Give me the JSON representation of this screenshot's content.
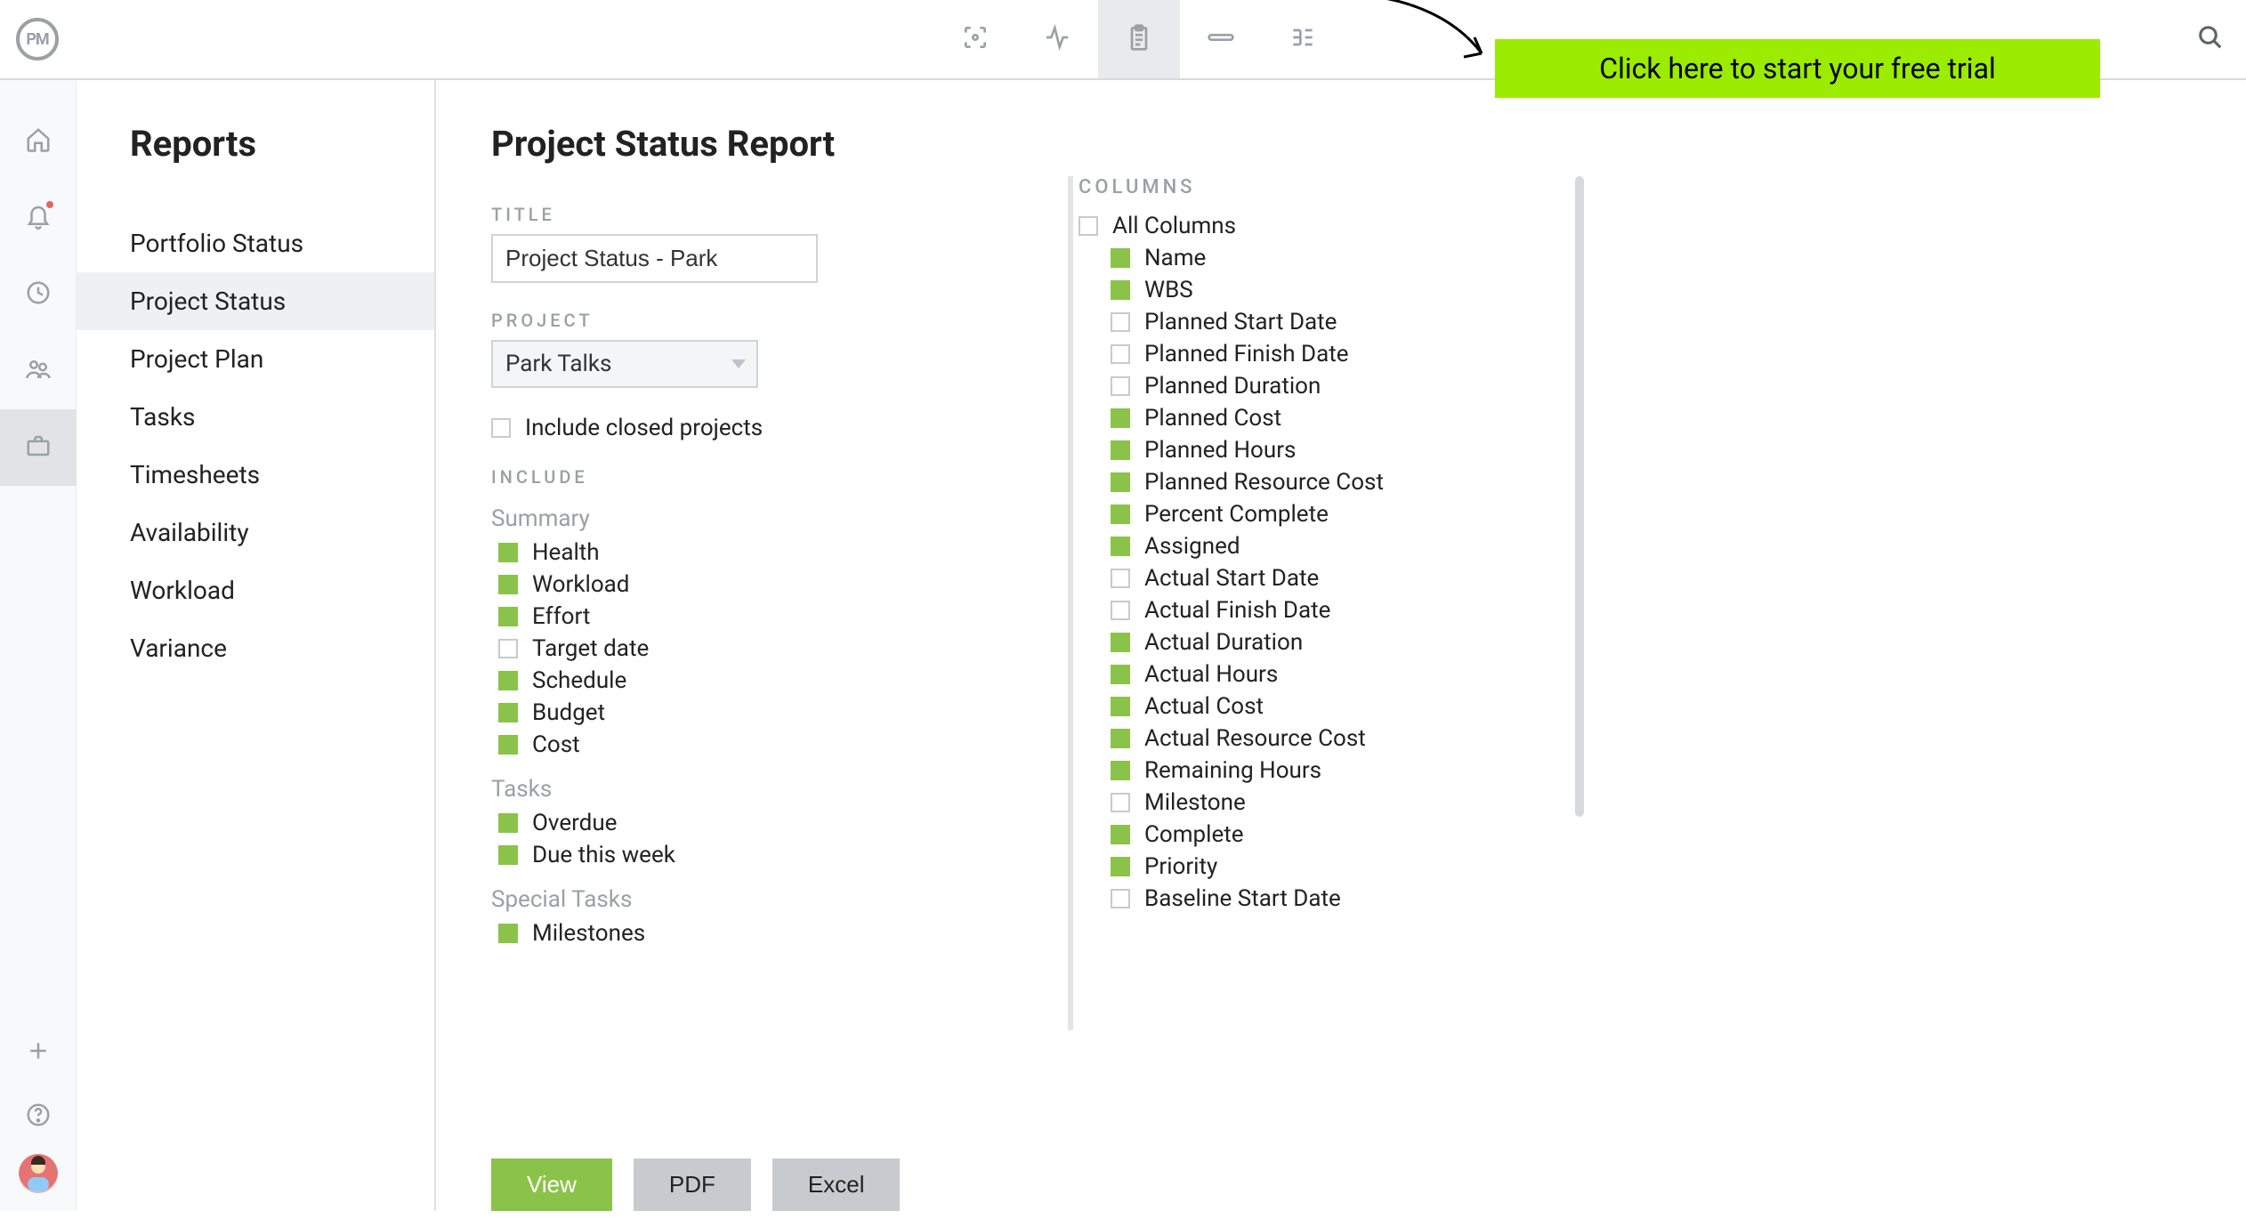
{
  "app": {
    "logo_text": "PM"
  },
  "cta": {
    "label": "Click here to start your free trial"
  },
  "sidebar": {
    "title": "Reports",
    "items": [
      {
        "label": "Portfolio Status",
        "active": false
      },
      {
        "label": "Project Status",
        "active": true
      },
      {
        "label": "Project Plan",
        "active": false
      },
      {
        "label": "Tasks",
        "active": false
      },
      {
        "label": "Timesheets",
        "active": false
      },
      {
        "label": "Availability",
        "active": false
      },
      {
        "label": "Workload",
        "active": false
      },
      {
        "label": "Variance",
        "active": false
      }
    ]
  },
  "page": {
    "title": "Project Status Report",
    "title_field_label": "TITLE",
    "title_value": "Project Status - Park",
    "project_field_label": "PROJECT",
    "project_value": "Park Talks",
    "include_closed_label": "Include closed projects",
    "include_closed_checked": false
  },
  "include": {
    "label": "INCLUDE",
    "summary_label": "Summary",
    "summary": [
      {
        "label": "Health",
        "checked": true
      },
      {
        "label": "Workload",
        "checked": true
      },
      {
        "label": "Effort",
        "checked": true
      },
      {
        "label": "Target date",
        "checked": false
      },
      {
        "label": "Schedule",
        "checked": true
      },
      {
        "label": "Budget",
        "checked": true
      },
      {
        "label": "Cost",
        "checked": true
      }
    ],
    "tasks_label": "Tasks",
    "tasks": [
      {
        "label": "Overdue",
        "checked": true
      },
      {
        "label": "Due this week",
        "checked": true
      }
    ],
    "special_label": "Special Tasks",
    "special": [
      {
        "label": "Milestones",
        "checked": true
      }
    ]
  },
  "columns": {
    "label": "COLUMNS",
    "all_label": "All Columns",
    "all_checked": false,
    "items": [
      {
        "label": "Name",
        "checked": true
      },
      {
        "label": "WBS",
        "checked": true
      },
      {
        "label": "Planned Start Date",
        "checked": false
      },
      {
        "label": "Planned Finish Date",
        "checked": false
      },
      {
        "label": "Planned Duration",
        "checked": false
      },
      {
        "label": "Planned Cost",
        "checked": true
      },
      {
        "label": "Planned Hours",
        "checked": true
      },
      {
        "label": "Planned Resource Cost",
        "checked": true
      },
      {
        "label": "Percent Complete",
        "checked": true
      },
      {
        "label": "Assigned",
        "checked": true
      },
      {
        "label": "Actual Start Date",
        "checked": false
      },
      {
        "label": "Actual Finish Date",
        "checked": false
      },
      {
        "label": "Actual Duration",
        "checked": true
      },
      {
        "label": "Actual Hours",
        "checked": true
      },
      {
        "label": "Actual Cost",
        "checked": true
      },
      {
        "label": "Actual Resource Cost",
        "checked": true
      },
      {
        "label": "Remaining Hours",
        "checked": true
      },
      {
        "label": "Milestone",
        "checked": false
      },
      {
        "label": "Complete",
        "checked": true
      },
      {
        "label": "Priority",
        "checked": true
      },
      {
        "label": "Baseline Start Date",
        "checked": false
      }
    ]
  },
  "actions": {
    "view": "View",
    "pdf": "PDF",
    "excel": "Excel"
  }
}
